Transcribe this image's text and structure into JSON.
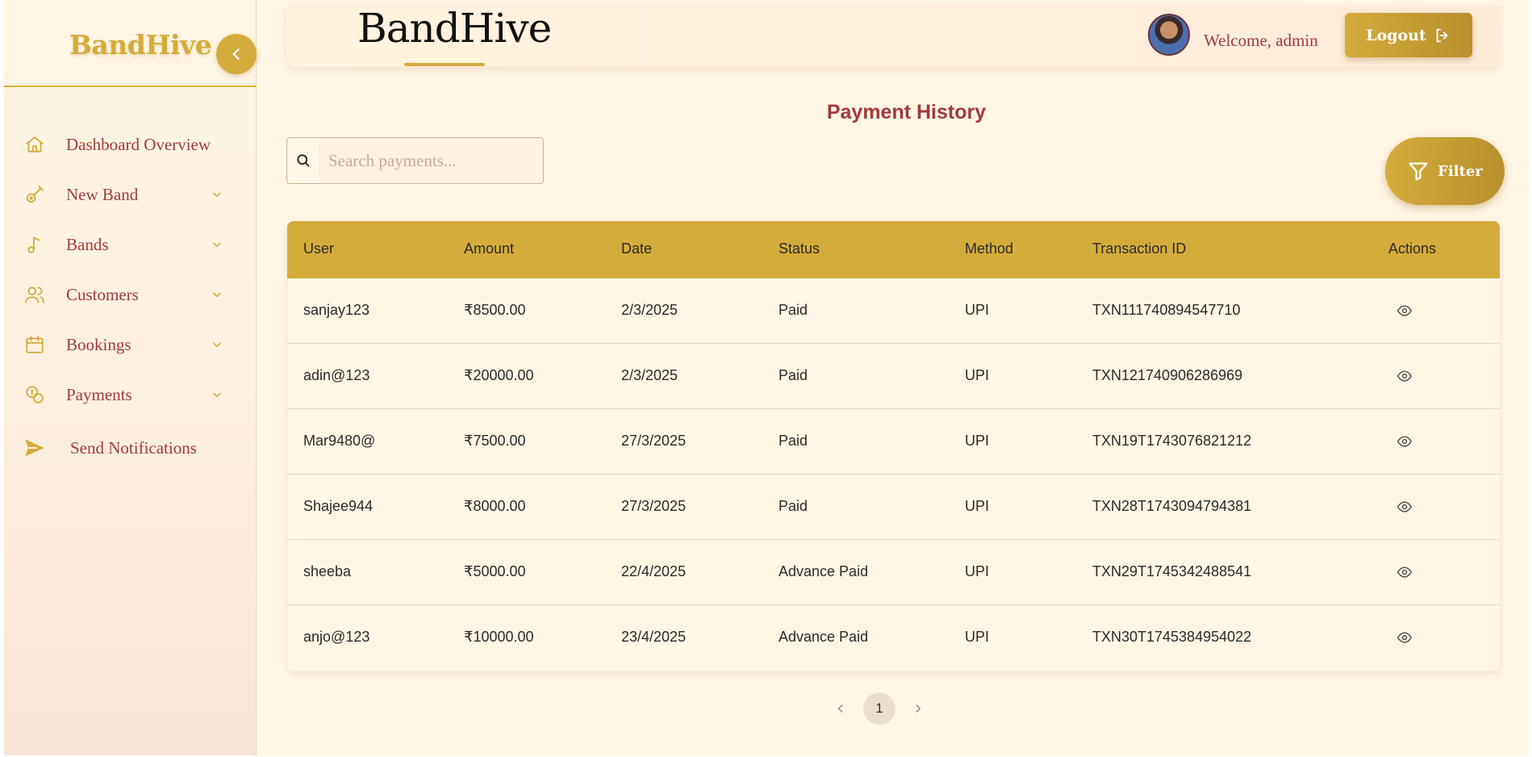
{
  "sidebar": {
    "brand": "BandHive",
    "items": [
      {
        "label": "Dashboard Overview",
        "icon": "home-icon",
        "expandable": false
      },
      {
        "label": "New Band",
        "icon": "guitar-icon",
        "expandable": true
      },
      {
        "label": "Bands",
        "icon": "music-note-icon",
        "expandable": true
      },
      {
        "label": "Customers",
        "icon": "users-icon",
        "expandable": true
      },
      {
        "label": "Bookings",
        "icon": "calendar-icon",
        "expandable": true
      },
      {
        "label": "Payments",
        "icon": "coins-icon",
        "expandable": true
      },
      {
        "label": "Send Notifications",
        "icon": "send-icon",
        "expandable": false
      }
    ]
  },
  "header": {
    "title": "BandHive",
    "welcome": "Welcome, admin",
    "logout_label": "Logout"
  },
  "main": {
    "heading": "Payment History",
    "search": {
      "placeholder": "Search payments...",
      "value": ""
    },
    "filter_label": "Filter",
    "table": {
      "columns": [
        "User",
        "Amount",
        "Date",
        "Status",
        "Method",
        "Transaction ID",
        "Actions"
      ],
      "rows": [
        {
          "user": "sanjay123",
          "amount": "₹8500.00",
          "date": "2/3/2025",
          "status": "Paid",
          "method": "UPI",
          "txn": "TXN111740894547710"
        },
        {
          "user": "adin@123",
          "amount": "₹20000.00",
          "date": "2/3/2025",
          "status": "Paid",
          "method": "UPI",
          "txn": "TXN121740906286969"
        },
        {
          "user": "Mar9480@",
          "amount": "₹7500.00",
          "date": "27/3/2025",
          "status": "Paid",
          "method": "UPI",
          "txn": "TXN19T1743076821212"
        },
        {
          "user": "Shajee944",
          "amount": "₹8000.00",
          "date": "27/3/2025",
          "status": "Paid",
          "method": "UPI",
          "txn": "TXN28T1743094794381"
        },
        {
          "user": "sheeba",
          "amount": "₹5000.00",
          "date": "22/4/2025",
          "status": "Advance Paid",
          "method": "UPI",
          "txn": "TXN29T1745342488541"
        },
        {
          "user": "anjo@123",
          "amount": "₹10000.00",
          "date": "23/4/2025",
          "status": "Advance Paid",
          "method": "UPI",
          "txn": "TXN30T1745384954022"
        }
      ]
    },
    "pagination": {
      "current_page": "1"
    }
  },
  "colors": {
    "accent": "#d4ac3c",
    "accent_dark": "#b88f2c",
    "text_maroon": "#a33a3a",
    "background": "#fff6e6"
  }
}
